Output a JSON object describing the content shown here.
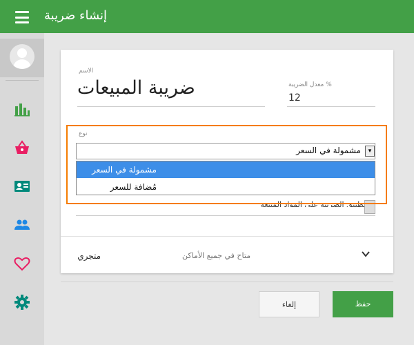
{
  "appbar": {
    "title": "إنشاء ضريبة"
  },
  "sidebar": {
    "items": [
      {
        "icon": "bar-chart-icon",
        "color": "#43a047"
      },
      {
        "icon": "basket-icon",
        "color": "#e91e63"
      },
      {
        "icon": "id-card-icon",
        "color": "#00897b"
      },
      {
        "icon": "people-icon",
        "color": "#1e88e5"
      },
      {
        "icon": "heart-icon",
        "color": "#e91e63"
      },
      {
        "icon": "gear-icon",
        "color": "#00897b"
      }
    ]
  },
  "form": {
    "name_label": "الاسم",
    "name_value": "ضريبة المبيعات",
    "rate_label": "% معدل الضريبة",
    "rate_value": "12",
    "type_label": "نوع",
    "type_value": "مشمولة في السعر",
    "type_options": [
      "مشمولة في السعر",
      "مُضافة للسعر"
    ],
    "type_selected_index": 0,
    "apply_label_obscured": "تطبيق الضريبة على المواد المبيعة"
  },
  "store": {
    "name": "متجري",
    "availability": "متاح في جميع الأماكن"
  },
  "buttons": {
    "cancel": "إلغاء",
    "save": "حفظ"
  },
  "colors": {
    "accent": "#43a047",
    "highlight": "#f57c00",
    "selected_option": "#3d8ee8"
  }
}
